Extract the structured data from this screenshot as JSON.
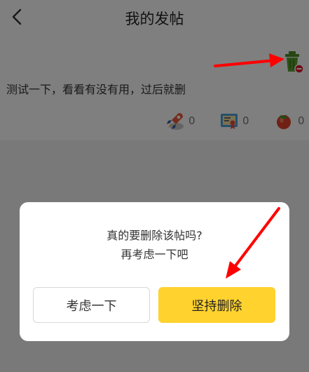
{
  "header": {
    "title": "我的发帖"
  },
  "post": {
    "text": "测试一下，看看有没有用，过后就删",
    "stats": [
      {
        "icon": "rocket-icon",
        "count": "0"
      },
      {
        "icon": "certificate-icon",
        "count": "0"
      },
      {
        "icon": "tomato-icon",
        "count": "0"
      }
    ]
  },
  "dialog": {
    "title": "真的要删除该帖吗?",
    "subtitle": "再考虑一下吧",
    "cancel_label": "考虑一下",
    "confirm_label": "坚持删除"
  },
  "colors": {
    "confirm_button": "#ffd22e",
    "annotation_arrow": "#ff0000",
    "trash_icon": "#5a9e2e"
  }
}
